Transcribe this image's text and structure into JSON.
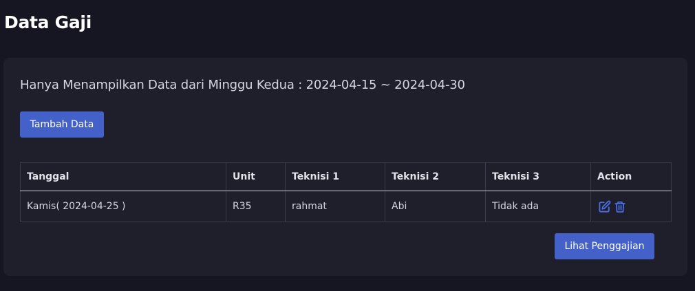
{
  "page": {
    "title": "Data Gaji"
  },
  "card": {
    "info": "Hanya Menampilkan Data dari Minggu Kedua : 2024-04-15 ~ 2024-04-30",
    "add_button": "Tambah Data",
    "view_button": "Lihat Penggajian"
  },
  "table": {
    "columns": [
      "Tanggal",
      "Unit",
      "Teknisi 1",
      "Teknisi 2",
      "Teknisi 3",
      "Action"
    ],
    "rows": [
      {
        "tanggal": "Kamis( 2024-04-25 )",
        "unit": "R35",
        "teknisi1": "rahmat",
        "teknisi2": "Abi",
        "teknisi3": "Tidak ada"
      }
    ]
  },
  "icons": {
    "edit": "edit-icon",
    "delete": "trash-icon"
  },
  "colors": {
    "background": "#161622",
    "card": "#1f1f2c",
    "accent": "#4361c8",
    "icon": "#4a6ee0"
  }
}
